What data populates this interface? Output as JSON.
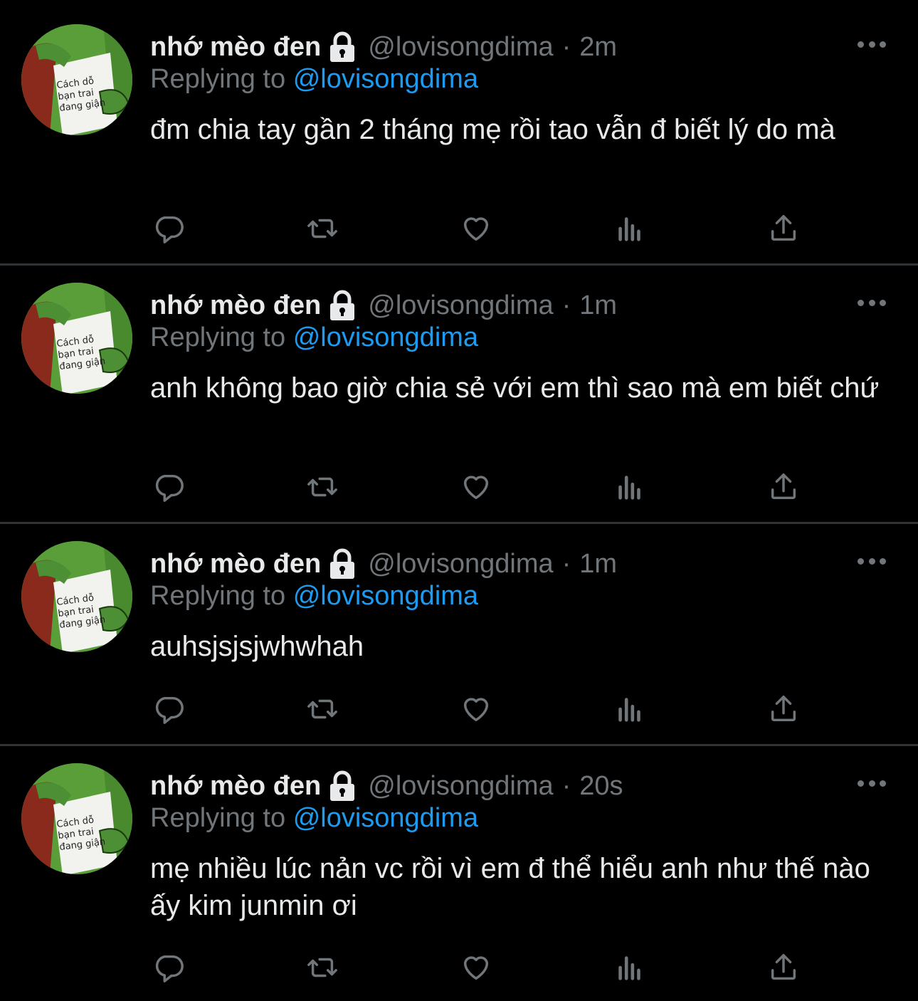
{
  "tweets": [
    {
      "name": "nhớ mèo đen",
      "handle": "@lovisongdima",
      "dot": "·",
      "time": "2m",
      "replying_label": "Replying to",
      "replying_to": "@lovisongdima",
      "text": "đm chia tay gần 2 tháng mẹ rồi tao vẫn đ biết lý do mà"
    },
    {
      "name": "nhớ mèo đen",
      "handle": "@lovisongdima",
      "dot": "·",
      "time": "1m",
      "replying_label": "Replying to",
      "replying_to": "@lovisongdima",
      "text": "anh không bao giờ chia sẻ với em thì sao mà em biết chứ"
    },
    {
      "name": "nhớ mèo đen",
      "handle": "@lovisongdima",
      "dot": "·",
      "time": "1m",
      "replying_label": "Replying to",
      "replying_to": "@lovisongdima",
      "text": "auhsjsjsjwhwhah"
    },
    {
      "name": "nhớ mèo đen",
      "handle": "@lovisongdima",
      "dot": "·",
      "time": "20s",
      "replying_label": "Replying to",
      "replying_to": "@lovisongdima",
      "text": "mẹ nhiều lúc nản vc rồi vì em đ thể hiểu anh như thế nào ấy kim junmin ơi"
    }
  ],
  "avatar_book_text": [
    "Cách dỗ",
    "bạn trai",
    "đang giận"
  ],
  "icons": {
    "lock": "lock-icon",
    "more": "more-icon",
    "reply": "reply-icon",
    "retweet": "retweet-icon",
    "like": "heart-icon",
    "analytics": "analytics-icon",
    "share": "share-icon"
  },
  "colors": {
    "background": "#000000",
    "text": "#e7e9ea",
    "secondary": "#71767b",
    "link": "#1d9bf0",
    "divider": "#2f3336"
  }
}
